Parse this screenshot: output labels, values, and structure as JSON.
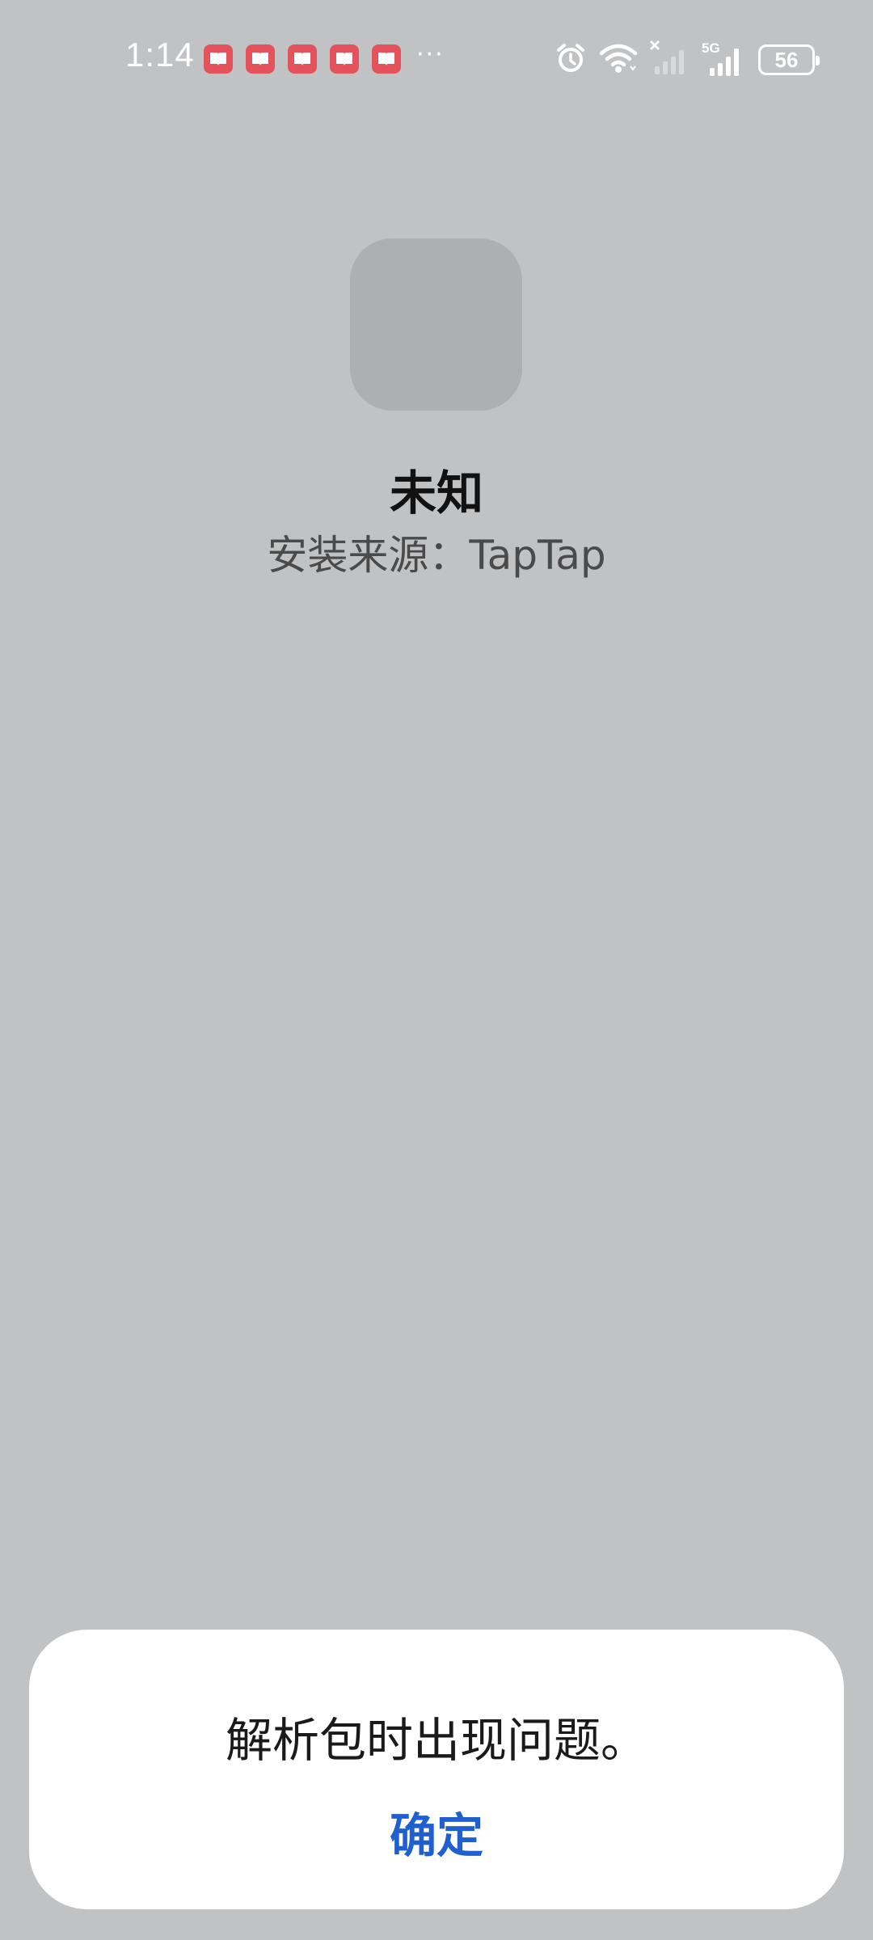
{
  "status_bar": {
    "time": "1:14",
    "more_indicator": "···",
    "notification_icons": [
      "book-app-icon",
      "book-app-icon",
      "book-app-icon",
      "book-app-icon",
      "book-app-icon"
    ],
    "network_label": "5G",
    "battery_level": "56"
  },
  "app": {
    "name": "未知",
    "install_source": "安装来源：TapTap"
  },
  "dialog": {
    "message": "解析包时出现问题。",
    "confirm_label": "确定"
  },
  "colors": {
    "background": "#c1c2c4",
    "accent": "#1f5fd0",
    "notification_badge": "#e4535c"
  }
}
